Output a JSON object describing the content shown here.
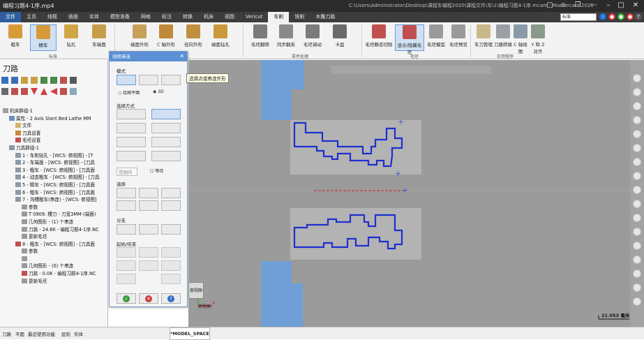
{
  "titlebar": {
    "video_name": "编程习题4-1序.mp4",
    "path": "C:\\Users\\Administrator\\Desktop\\课程车编程2020\\课程文件\\车\\1\\编程习题4-1序.mcam - Mastercam 2020"
  },
  "tabs": [
    "文件",
    "主页",
    "线框",
    "曲面",
    "实体",
    "模型准备",
    "网格",
    "标注",
    "转换",
    "机床",
    "视图",
    "Vericut",
    "车削",
    "铣削",
    "木雕刀路"
  ],
  "tabs_right": {
    "search": "标准"
  },
  "ribbon": {
    "buttons": [
      {
        "label": "粗车",
        "color": "#d79a3a"
      },
      {
        "label": "精车",
        "color": "#d79a3a",
        "selected": true
      },
      {
        "label": "钻孔",
        "color": "#d0a545"
      },
      {
        "label": "车端面",
        "color": "#c79c4b"
      },
      {
        "label": "端面外形",
        "color": "#c8a05a"
      },
      {
        "label": "C 轴外形",
        "color": "#bf8a3a"
      },
      {
        "label": "径向外形",
        "color": "#c09040"
      },
      {
        "label": "端面钻孔",
        "color": "#c99a3c"
      },
      {
        "label": "毛坯翻转",
        "color": "#7a7a7a"
      },
      {
        "label": "同步翻夹",
        "color": "#8a8a8a"
      },
      {
        "label": "毛坯调动",
        "color": "#7c7c7c"
      },
      {
        "label": "卡盘",
        "color": "#6a6a6a"
      },
      {
        "label": "毛坯静态切削",
        "color": "#c05050"
      },
      {
        "label": "显示/隐藏毛坯",
        "color": "#c05050"
      },
      {
        "label": "毛坯模型",
        "color": "#9a9a9a"
      },
      {
        "label": "毛坯预览",
        "color": "#9a9a9a"
      },
      {
        "label": "车刀管理",
        "color": "#c9b88a"
      },
      {
        "label": "刀路转换",
        "color": "#9aa0a6"
      },
      {
        "label": "C 轴视图",
        "color": "#8a9aa8"
      },
      {
        "label": "Y 和 Z 对齐",
        "color": "#8a9a8a"
      }
    ],
    "groups": [
      "标准",
      "零件处理",
      "毛坯",
      "实用程序"
    ]
  },
  "left_panel": {
    "title": "刀路",
    "tree": [
      {
        "indent": 0,
        "text": "机床群组-1",
        "icon": "#9aa0a6"
      },
      {
        "indent": 1,
        "text": "属性 - 2 Axis Slant Bed Lathe MM",
        "icon": "#6a8fbf"
      },
      {
        "indent": 2,
        "text": "文件",
        "icon": "#d4b36a"
      },
      {
        "indent": 2,
        "text": "刀具设置",
        "icon": "#c98a3a"
      },
      {
        "indent": 2,
        "text": "毛坯设置",
        "icon": "#c05050"
      },
      {
        "indent": 1,
        "text": "刀具群组-1",
        "icon": "#8a9aa8"
      },
      {
        "indent": 2,
        "text": "1 - 车削钻孔 - [WCS: 俯视图] - [T",
        "icon": "#8a9aa8"
      },
      {
        "indent": 2,
        "text": "2 - 车端面 - [WCS: 俯视图] - [刀具",
        "icon": "#8a9aa8"
      },
      {
        "indent": 2,
        "text": "3 - 粗车 - [WCS: 俯视图] - [刀具面",
        "icon": "#8a9aa8"
      },
      {
        "indent": 2,
        "text": "4 - 动态粗车 - [WCS: 俯视图] - [刀具",
        "icon": "#8a9aa8"
      },
      {
        "indent": 2,
        "text": "5 - 精车 - [WCS: 俯视图] - [刀具面",
        "icon": "#8a9aa8"
      },
      {
        "indent": 2,
        "text": "6 - 粗车 - [WCS: 俯视图] - [刀具面",
        "icon": "#8a9aa8"
      },
      {
        "indent": 2,
        "text": "7 - 沟槽粗车(串连) - [WCS: 俯视图]",
        "icon": "#8a9aa8"
      },
      {
        "indent": 3,
        "text": "参数",
        "icon": "#9a9a9a"
      },
      {
        "indent": 3,
        "text": "T 0909: 槽刀 - 刀宽3MM-(端面)",
        "icon": "#9a9a9a"
      },
      {
        "indent": 3,
        "text": "几何图形 - (1) 个串连",
        "icon": "#9a9a9a"
      },
      {
        "indent": 3,
        "text": "刀路 - 24.6K - 编程习题4-1序.NC",
        "icon": "#9a9a9a"
      },
      {
        "indent": 3,
        "text": "更新毛坯",
        "icon": "#9a9a9a"
      },
      {
        "indent": 2,
        "text": "8 - 粗车 - [WCS: 俯视图] - [刀具面",
        "icon": "#c05050"
      },
      {
        "indent": 3,
        "text": "参数",
        "icon": "#9a9a9a"
      },
      {
        "indent": 3,
        "text": "",
        "icon": "#9a9a9a"
      },
      {
        "indent": 3,
        "text": "几何图形 - (0) 个串连",
        "icon": "#9a9a9a"
      },
      {
        "indent": 3,
        "text": "刀路 - 0.0K - 编程习题4-1序.NC",
        "icon": "#c05050"
      },
      {
        "indent": 3,
        "text": "更新毛坯",
        "icon": "#9a9a9a"
      }
    ]
  },
  "dialog": {
    "title": "线框串连",
    "mode_label": "模式",
    "radio_a": "绘图平面",
    "radio_b": "3D",
    "select_method": "选择方式",
    "range_label": "范围内",
    "wait_label": "等待",
    "select_label": "选择",
    "branch_label": "分支",
    "start_end_label": "起始/结束"
  },
  "tooltip": "选择点或串连外形",
  "viewport": {
    "corner_label": "俯视图",
    "scale_text": "21.053 毫米",
    "axis_y": "Y",
    "axis_x": "X"
  },
  "bottom_tabs": [
    "刀路",
    "平面",
    "最近使用功能",
    "层别",
    "实体"
  ],
  "model_space": "*MODEL_SPACE"
}
